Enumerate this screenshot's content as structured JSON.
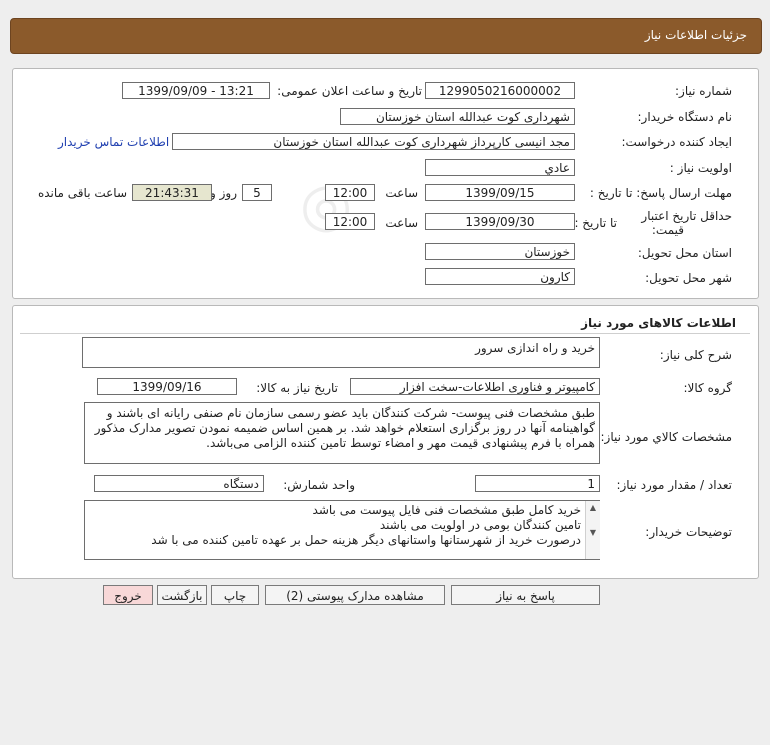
{
  "header": {
    "title": "جزئیات اطلاعات نیاز"
  },
  "info": {
    "need_number_label": "شماره نیاز:",
    "need_number": "1299050216000002",
    "announce_label": "تاریخ و ساعت اعلان عمومی:",
    "announce_value": "1399/09/09 - 13:21",
    "buyer_org_label": "نام دستگاه خریدار:",
    "buyer_org": "شهرداری کوت عبدالله استان خوزستان",
    "requester_label": "ایجاد کننده درخواست:",
    "requester": "مجد انیسی کارپرداز شهرداری کوت عبدالله استان خوزستان",
    "contact_link": "اطلاعات تماس خریدار",
    "priority_label": "اولویت نیاز :",
    "priority": "عادي",
    "reply_deadline_label": "مهلت ارسال پاسخ: تا تاریخ :",
    "reply_date": "1399/09/15",
    "time_label": "ساعت",
    "reply_time": "12:00",
    "days_value": "5",
    "days_label": "روز و",
    "remaining_time": "21:43:31",
    "remaining_label": "ساعت باقی مانده",
    "validity_label_1": "حداقل تاریخ اعتبار",
    "validity_label_2": "قیمت:",
    "validity_until_label": "تا تاریخ :",
    "validity_date": "1399/09/30",
    "validity_time_label": "ساعت",
    "validity_time": "12:00",
    "province_label": "استان محل تحویل:",
    "province": "خوزستان",
    "city_label": "شهر محل تحویل:",
    "city": "کارون"
  },
  "goods": {
    "section_title": "اطلاعات کالاهای مورد نیاز",
    "summary_label": "شرح کلی نیاز:",
    "summary": "خرید و راه اندازی سرور",
    "group_label": "گروه کالا:",
    "group": "کامپیوتر و فناوری اطلاعات-سخت افزار",
    "need_date_label": "تاریخ نیاز به کالا:",
    "need_date": "1399/09/16",
    "specs_label": "مشخصات کالاي مورد نیاز:",
    "specs": "طبق مشخصات فنی پیوست- شرکت کنندگان باید عضو رسمی سازمان نام صنفی رایانه ای باشند و گواهینامه آنها در روز برگزاری استعلام خواهد شد. بر همین اساس ضمیمه نمودن تصویر مدارک مذکور همراه با فرم پیشنهادی قیمت مهر و امضاء توسط تامین کننده الزامی می‌باشد.",
    "qty_label": "تعداد / مقدار مورد نیاز:",
    "qty": "1",
    "unit_label": "واحد شمارش:",
    "unit": "دستگاه",
    "notes_label": "توضیحات خریدار:",
    "notes": [
      "خرید کامل طبق مشخصات فنی فایل پیوست می باشد",
      "تامین کنندگان بومی در اولویت می باشند",
      "درصورت خرید از شهرستانها واستانهای دیگر هزینه حمل بر عهده تامین کننده می با شد"
    ]
  },
  "buttons": {
    "reply": "پاسخ به نیاز",
    "attachments": "مشاهده مدارک پیوستی (2)",
    "print": "چاپ",
    "back": "بازگشت",
    "exit": "خروج"
  }
}
